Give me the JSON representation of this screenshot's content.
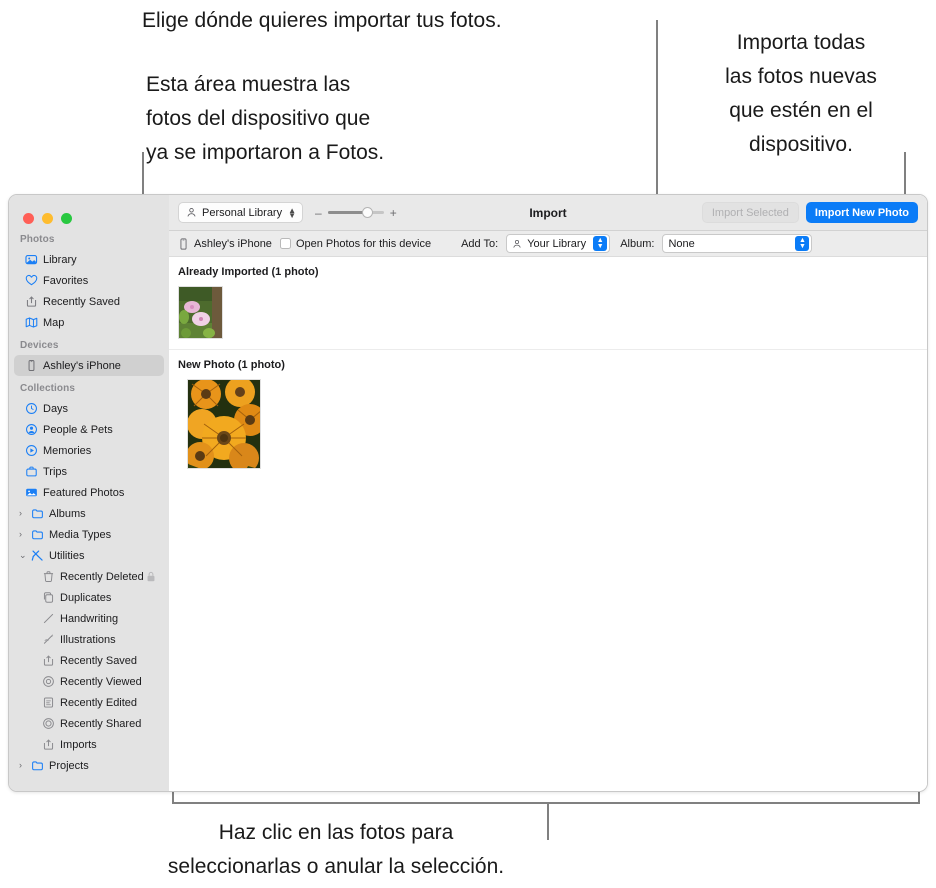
{
  "annotations": {
    "top_center": "Elige dónde quieres importar tus fotos.",
    "top_left": "Esta área muestra las\nfotos del dispositivo que\nya se importaron a Fotos.",
    "top_right": "Importa todas\nlas fotos nuevas\nque estén en el\ndispositivo.",
    "bottom": "Haz clic en las fotos para\nseleccionarlas o anular la selección."
  },
  "window": {
    "traffic_lights": {
      "close": "close-button",
      "minimize": "minimize-button",
      "zoom": "zoom-button"
    }
  },
  "toolbar": {
    "library_popup": "Personal Library",
    "zoom_out": "–",
    "zoom_in": "+",
    "title": "Import",
    "import_selected": "Import Selected",
    "import_new_photo": "Import New Photo"
  },
  "subbar": {
    "device_name": "Ashley's iPhone",
    "open_photos_label": "Open Photos for this device",
    "add_to_label": "Add To:",
    "add_to_value": "Your Library",
    "album_label": "Album:",
    "album_value": "None"
  },
  "sidebar": {
    "sections": [
      {
        "header": "Photos",
        "items": [
          {
            "label": "Library",
            "icon": "library-icon"
          },
          {
            "label": "Favorites",
            "icon": "heart-icon"
          },
          {
            "label": "Recently Saved",
            "icon": "save-icon"
          },
          {
            "label": "Map",
            "icon": "map-icon"
          }
        ]
      },
      {
        "header": "Devices",
        "items": [
          {
            "label": "Ashley's iPhone",
            "icon": "iphone-icon",
            "selected": true
          }
        ]
      },
      {
        "header": "Collections",
        "items": [
          {
            "label": "Days",
            "icon": "clock-icon"
          },
          {
            "label": "People & Pets",
            "icon": "person-icon"
          },
          {
            "label": "Memories",
            "icon": "memories-icon"
          },
          {
            "label": "Trips",
            "icon": "trips-icon"
          },
          {
            "label": "Featured Photos",
            "icon": "featured-icon"
          },
          {
            "label": "Albums",
            "icon": "folder-icon",
            "disclosure": "›"
          },
          {
            "label": "Media Types",
            "icon": "folder-icon",
            "disclosure": "›"
          },
          {
            "label": "Utilities",
            "icon": "tools-icon",
            "disclosure": "⌄"
          },
          {
            "label": "Recently Deleted",
            "icon": "trash-icon",
            "indent": true,
            "trailing": "lock-icon"
          },
          {
            "label": "Duplicates",
            "icon": "duplicates-icon",
            "indent": true
          },
          {
            "label": "Handwriting",
            "icon": "pen-icon",
            "indent": true
          },
          {
            "label": "Illustrations",
            "icon": "illustrations-icon",
            "indent": true
          },
          {
            "label": "Recently Saved",
            "icon": "save-icon",
            "indent": true
          },
          {
            "label": "Recently Viewed",
            "icon": "viewed-icon",
            "indent": true
          },
          {
            "label": "Recently Edited",
            "icon": "edited-icon",
            "indent": true
          },
          {
            "label": "Recently Shared",
            "icon": "shared-icon",
            "indent": true
          },
          {
            "label": "Imports",
            "icon": "save-icon",
            "indent": true
          },
          {
            "label": "Projects",
            "icon": "folder-icon",
            "disclosure": "›"
          }
        ]
      }
    ]
  },
  "content": {
    "groups": [
      {
        "title": "Already Imported (1 photo)",
        "photo_count": 1,
        "photo_alt": "pink-cosmos-flowers-thumbnail"
      },
      {
        "title": "New Photo (1 photo)",
        "photo_count": 1,
        "photo_alt": "orange-rudbeckia-flowers-thumbnail"
      }
    ]
  },
  "colors": {
    "accent": "#0b7cf7",
    "sidebar_bg": "#e3e3e3",
    "toolbar_bg": "#e9e9e9",
    "callout_line": "#808080"
  }
}
